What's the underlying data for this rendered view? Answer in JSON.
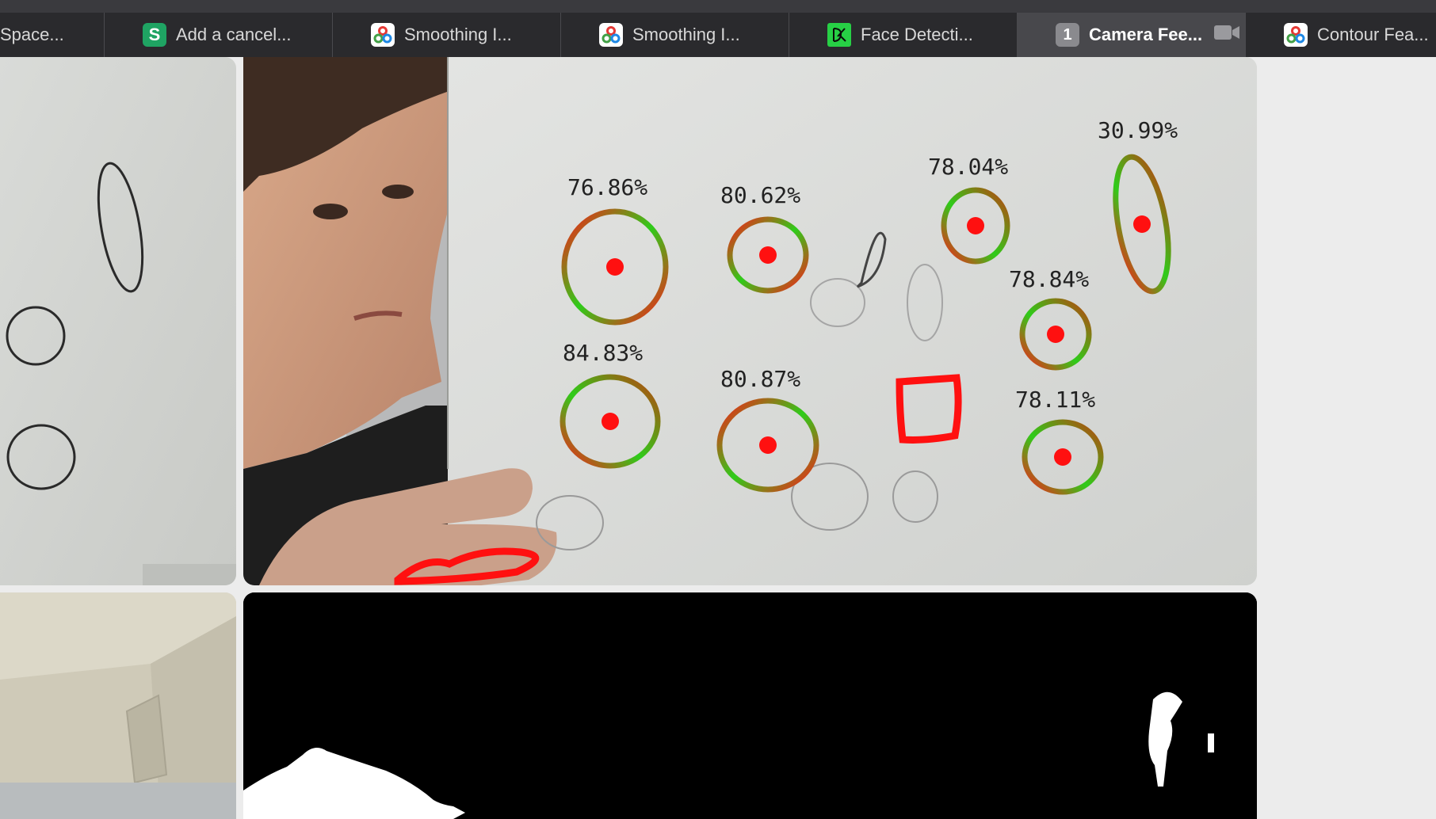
{
  "tabs": [
    {
      "label": "Space...",
      "icon": "none",
      "active": false
    },
    {
      "label": "Add a cancel...",
      "icon": "s-logo-icon",
      "active": false
    },
    {
      "label": "Smoothing I...",
      "icon": "opencv-icon",
      "active": false
    },
    {
      "label": "Smoothing I...",
      "icon": "opencv-icon",
      "active": false
    },
    {
      "label": "Face Detecti...",
      "icon": "dk-logo-icon",
      "active": false
    },
    {
      "label": "Camera Fee...",
      "icon": "tab-number-badge",
      "badge": "1",
      "active": true
    },
    {
      "label": "Contour Fea...",
      "icon": "opencv-icon",
      "active": false
    }
  ],
  "detections": [
    {
      "label": "76.86%"
    },
    {
      "label": "80.62%"
    },
    {
      "label": "78.04%"
    },
    {
      "label": "30.99%"
    },
    {
      "label": "78.84%"
    },
    {
      "label": "84.83%"
    },
    {
      "label": "80.87%"
    },
    {
      "label": "78.11%"
    }
  ],
  "colors": {
    "tab_bar": "#2a2a2d",
    "active_tab": "#48484c",
    "contour_green": "#2ecc1a",
    "contour_red": "#ff1a1a",
    "center_dot": "#ff1010",
    "mask_background": "#000000"
  }
}
